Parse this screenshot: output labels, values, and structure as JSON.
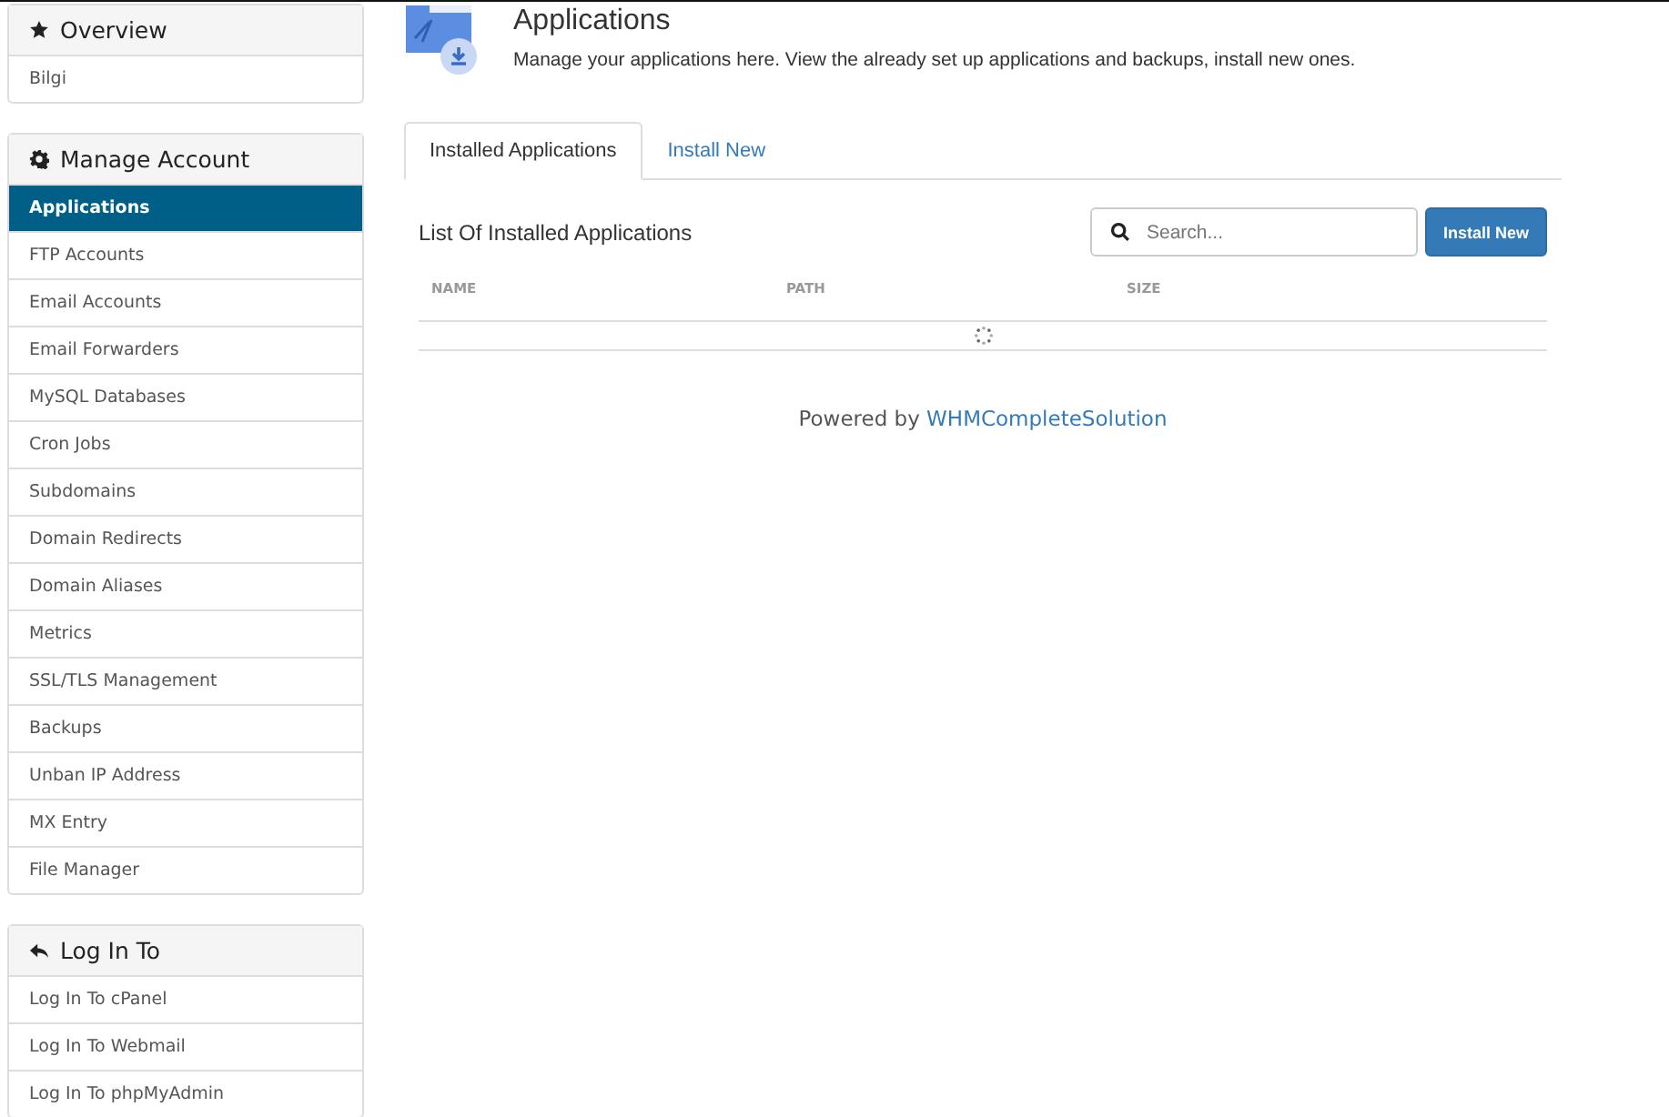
{
  "sidebar": {
    "panels": [
      {
        "title": "Overview",
        "items": [
          {
            "label": "Bilgi",
            "selected": false
          }
        ]
      },
      {
        "title": "Manage Account",
        "items": [
          {
            "label": "Applications",
            "selected": true
          },
          {
            "label": "FTP Accounts",
            "selected": false
          },
          {
            "label": "Email Accounts",
            "selected": false
          },
          {
            "label": "Email Forwarders",
            "selected": false
          },
          {
            "label": "MySQL Databases",
            "selected": false
          },
          {
            "label": "Cron Jobs",
            "selected": false
          },
          {
            "label": "Subdomains",
            "selected": false
          },
          {
            "label": "Domain Redirects",
            "selected": false
          },
          {
            "label": "Domain Aliases",
            "selected": false
          },
          {
            "label": "Metrics",
            "selected": false
          },
          {
            "label": "SSL/TLS Management",
            "selected": false
          },
          {
            "label": "Backups",
            "selected": false
          },
          {
            "label": "Unban IP Address",
            "selected": false
          },
          {
            "label": "MX Entry",
            "selected": false
          },
          {
            "label": "File Manager",
            "selected": false
          }
        ]
      },
      {
        "title": "Log In To",
        "items": [
          {
            "label": "Log In To cPanel",
            "selected": false
          },
          {
            "label": "Log In To Webmail",
            "selected": false
          },
          {
            "label": "Log In To phpMyAdmin",
            "selected": false
          }
        ]
      }
    ]
  },
  "header": {
    "title": "Applications",
    "description": "Manage your applications here. View the already set up applications and backups, install new ones."
  },
  "tabs": [
    {
      "label": "Installed Applications",
      "selected": true
    },
    {
      "label": "Install New",
      "selected": false
    }
  ],
  "list": {
    "title": "List Of Installed Applications",
    "search": {
      "placeholder": "Search..."
    },
    "button": "Install New",
    "columns": [
      "NAME",
      "PATH",
      "SIZE"
    ]
  },
  "footer": {
    "text": "Powered by",
    "link": "WHMCompleteSolution"
  }
}
